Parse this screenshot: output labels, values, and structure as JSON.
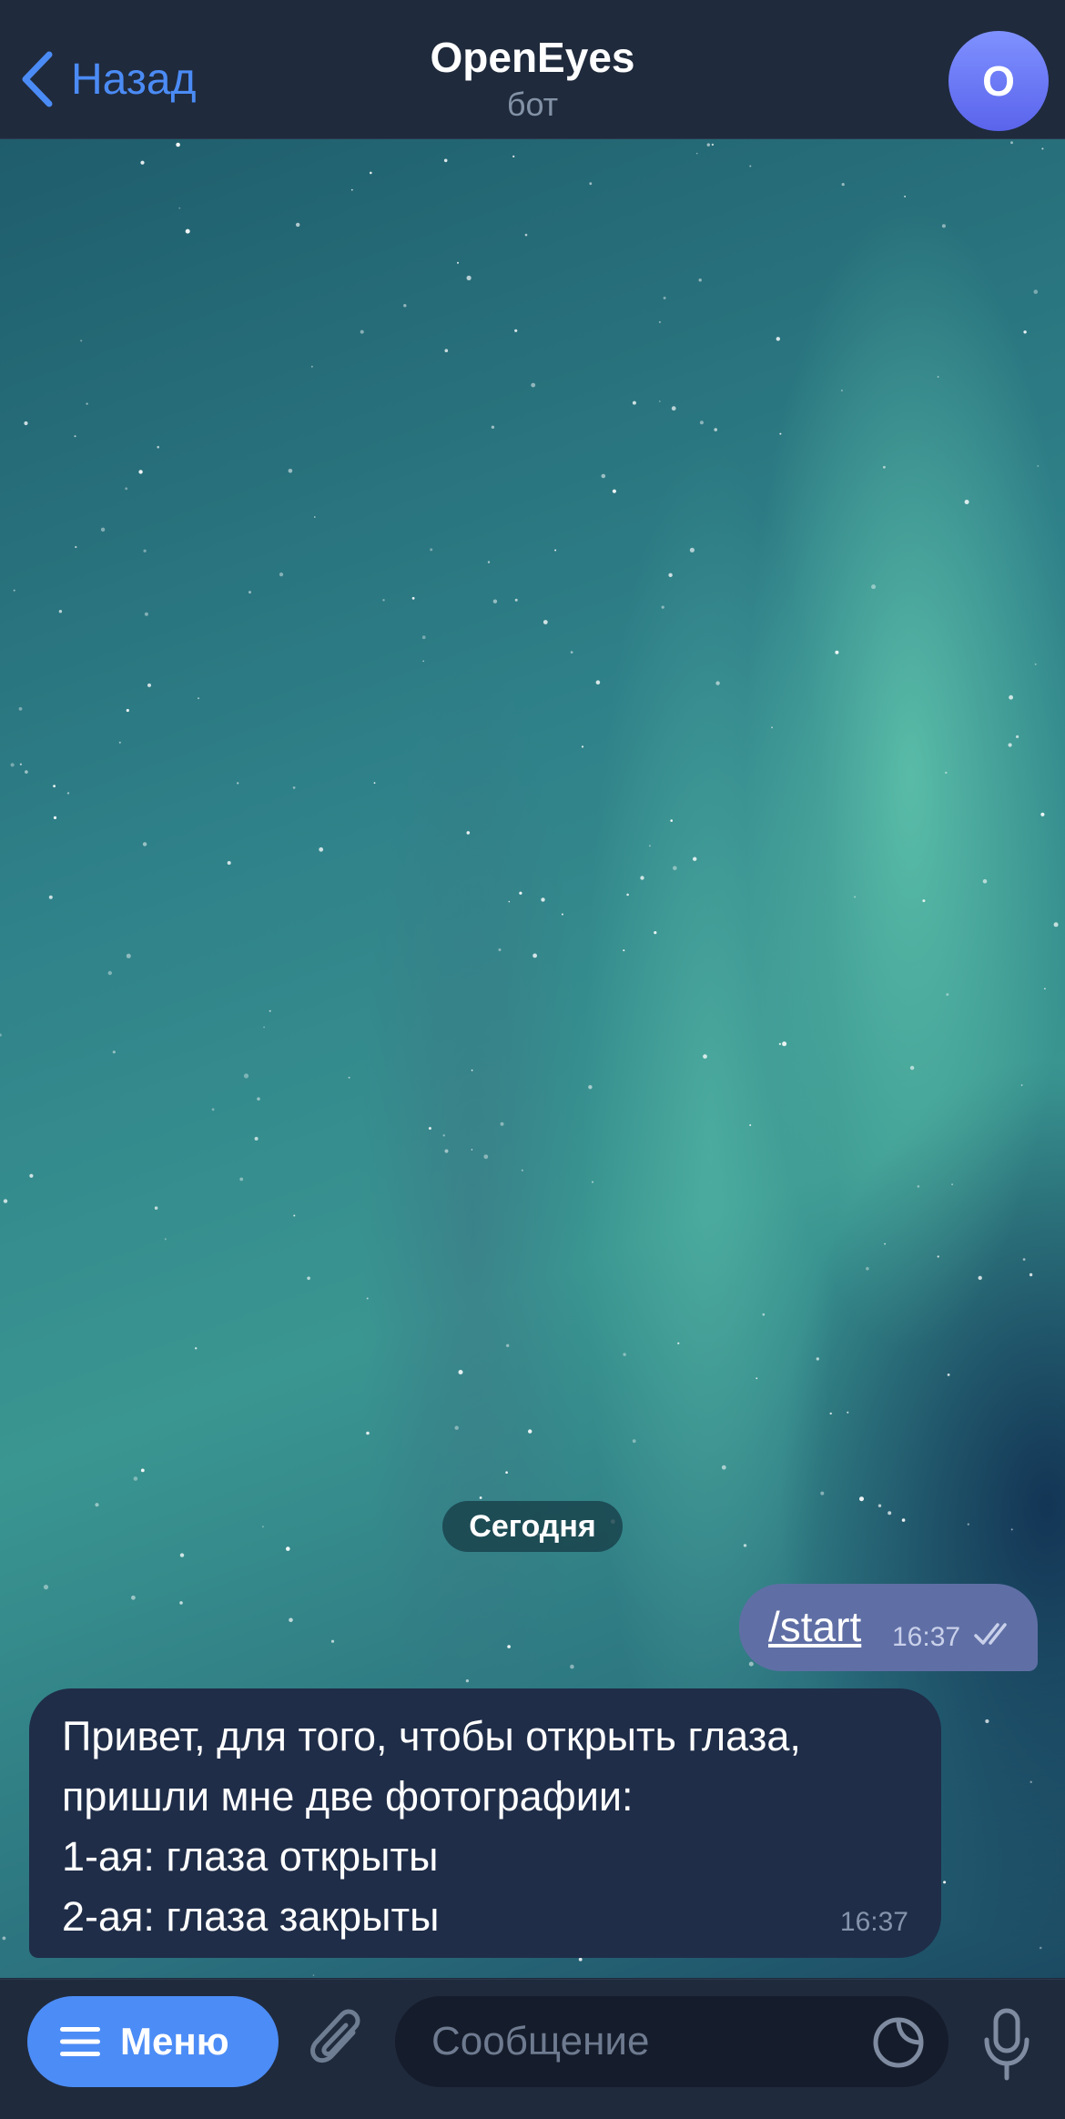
{
  "header": {
    "back_label": "Назад",
    "title": "OpenEyes",
    "subtitle": "бот",
    "avatar_letter": "O",
    "avatar_colors": [
      "#7f91ff",
      "#5a64ec"
    ]
  },
  "chat": {
    "date_label": "Сегодня",
    "messages": [
      {
        "direction": "outgoing",
        "text": "/start",
        "time": "16:37",
        "status": "read"
      },
      {
        "direction": "incoming",
        "text": "Привет, для того, чтобы открыть глаза,\nпришли мне две фотографии:\n1-ая: глаза открыты\n2-ая: глаза закрыты",
        "time": "16:37"
      }
    ]
  },
  "composer": {
    "menu_label": "Меню",
    "placeholder": "Сообщение",
    "icons": [
      "menu-icon",
      "paperclip-icon",
      "sticker-icon",
      "microphone-icon"
    ]
  },
  "colors": {
    "accent": "#4c8cf6",
    "outgoing_bubble": "#5f6fa5",
    "incoming_bubble": "#1f2d48",
    "bar_background": "#1f2a3c"
  }
}
